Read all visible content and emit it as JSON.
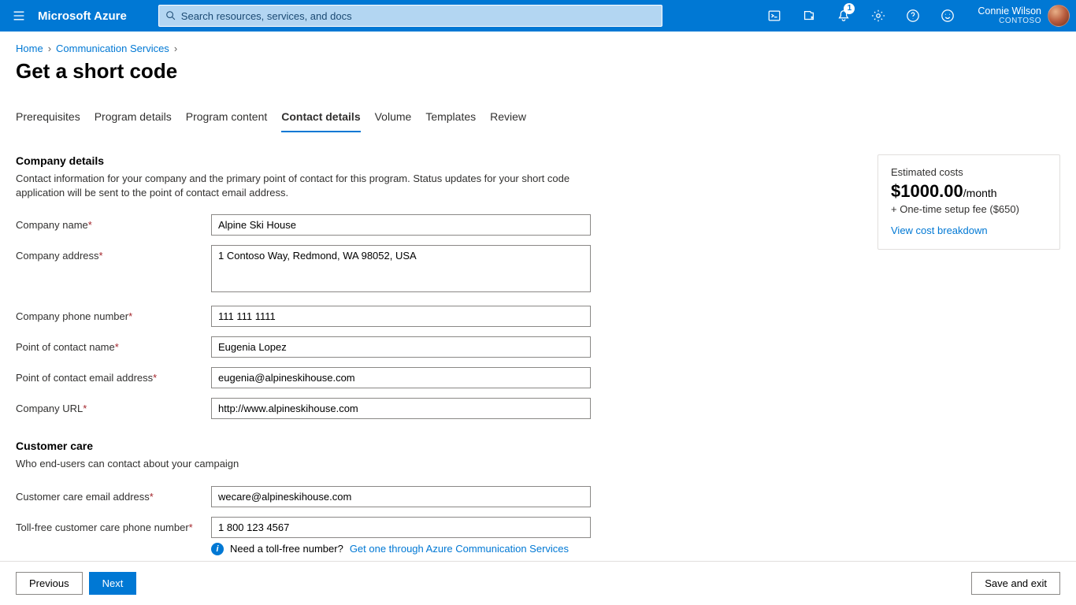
{
  "header": {
    "brand": "Microsoft Azure",
    "search_placeholder": "Search resources, services, and docs",
    "notification_count": "1",
    "user_name": "Connie Wilson",
    "tenant": "CONTOSO"
  },
  "breadcrumb": {
    "home": "Home",
    "service": "Communication Services"
  },
  "page_title": "Get a short code",
  "tabs": [
    {
      "label": "Prerequisites"
    },
    {
      "label": "Program details"
    },
    {
      "label": "Program content"
    },
    {
      "label": "Contact details",
      "active": true
    },
    {
      "label": "Volume"
    },
    {
      "label": "Templates"
    },
    {
      "label": "Review"
    }
  ],
  "company": {
    "heading": "Company details",
    "desc": "Contact information for your company and the primary point of contact for this program. Status updates for your short code application will be sent to the point of contact email address.",
    "fields": {
      "name_label": "Company name",
      "name_value": "Alpine Ski House",
      "address_label": "Company address",
      "address_value": "1 Contoso Way, Redmond, WA 98052, USA",
      "phone_label": "Company phone number",
      "phone_value": "111 111 1111",
      "poc_name_label": "Point of contact name",
      "poc_name_value": "Eugenia Lopez",
      "poc_email_label": "Point of contact email address",
      "poc_email_value": "eugenia@alpineskihouse.com",
      "url_label": "Company URL",
      "url_value": "http://www.alpineskihouse.com"
    }
  },
  "care": {
    "heading": "Customer care",
    "desc": "Who end-users can contact about your campaign",
    "fields": {
      "email_label": "Customer care email address",
      "email_value": "wecare@alpineskihouse.com",
      "tollfree_label": "Toll-free customer care phone number",
      "tollfree_value": "1 800 123 4567"
    },
    "hint_text": "Need a toll-free number?",
    "hint_link": "Get one through Azure Communication Services"
  },
  "cost": {
    "title": "Estimated costs",
    "price": "$1000.00",
    "per": "/month",
    "fee": "+ One-time setup fee ($650)",
    "link": "View cost breakdown"
  },
  "footer": {
    "previous": "Previous",
    "next": "Next",
    "save_exit": "Save and exit"
  }
}
